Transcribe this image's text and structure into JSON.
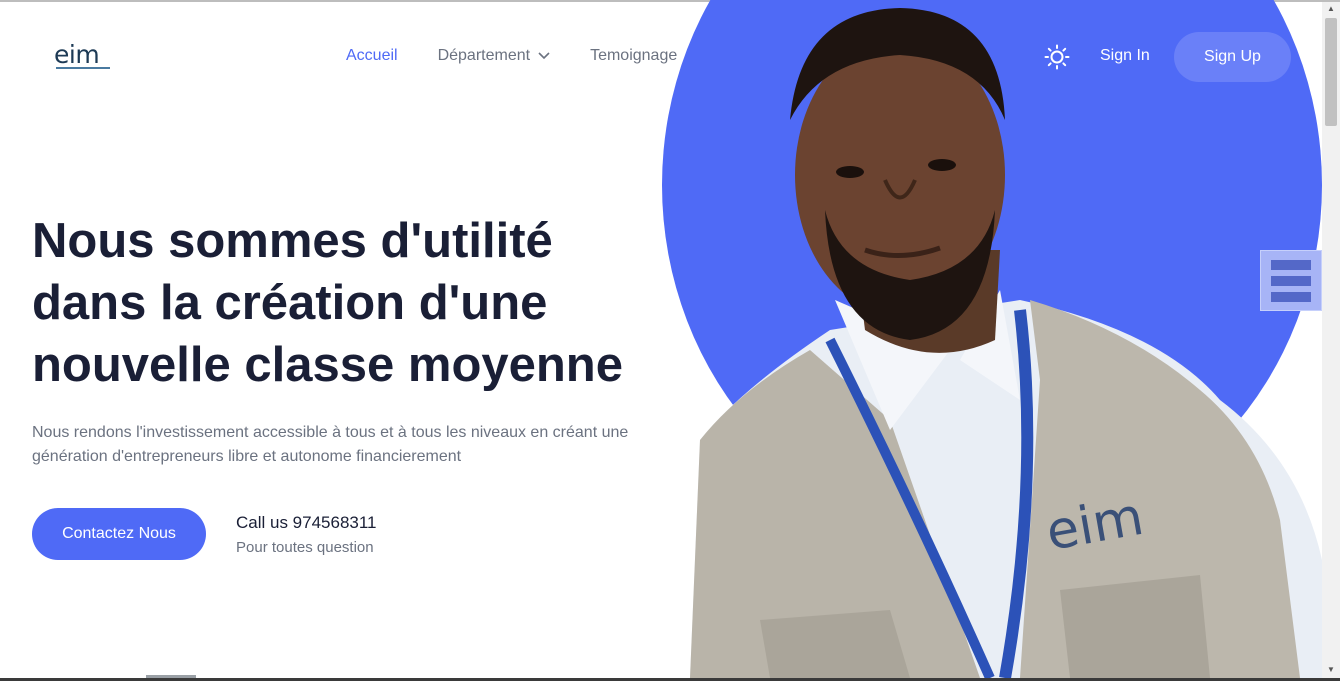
{
  "logo": {
    "text": "eim"
  },
  "nav": {
    "items": [
      {
        "label": "Accueil"
      },
      {
        "label": "Département"
      },
      {
        "label": "Temoignage"
      }
    ]
  },
  "header": {
    "sign_in": "Sign In",
    "sign_up": "Sign Up",
    "theme_icon": "sun-icon"
  },
  "hero": {
    "headline": "Nous sommes d'utilité dans la création d'une nouvelle classe moyenne",
    "subtext": "Nous rendons l'investissement accessible à tous et à tous les niveaux en créant une génération d'entrepreneurs libre et autonome financierement",
    "cta": "Contactez Nous",
    "call": "Call us 974568311",
    "call_sub": "Pour toutes question",
    "vest_logo": "eim"
  },
  "colors": {
    "accent": "#4f6af6",
    "text": "#1a1f36",
    "muted": "#6b7280"
  }
}
